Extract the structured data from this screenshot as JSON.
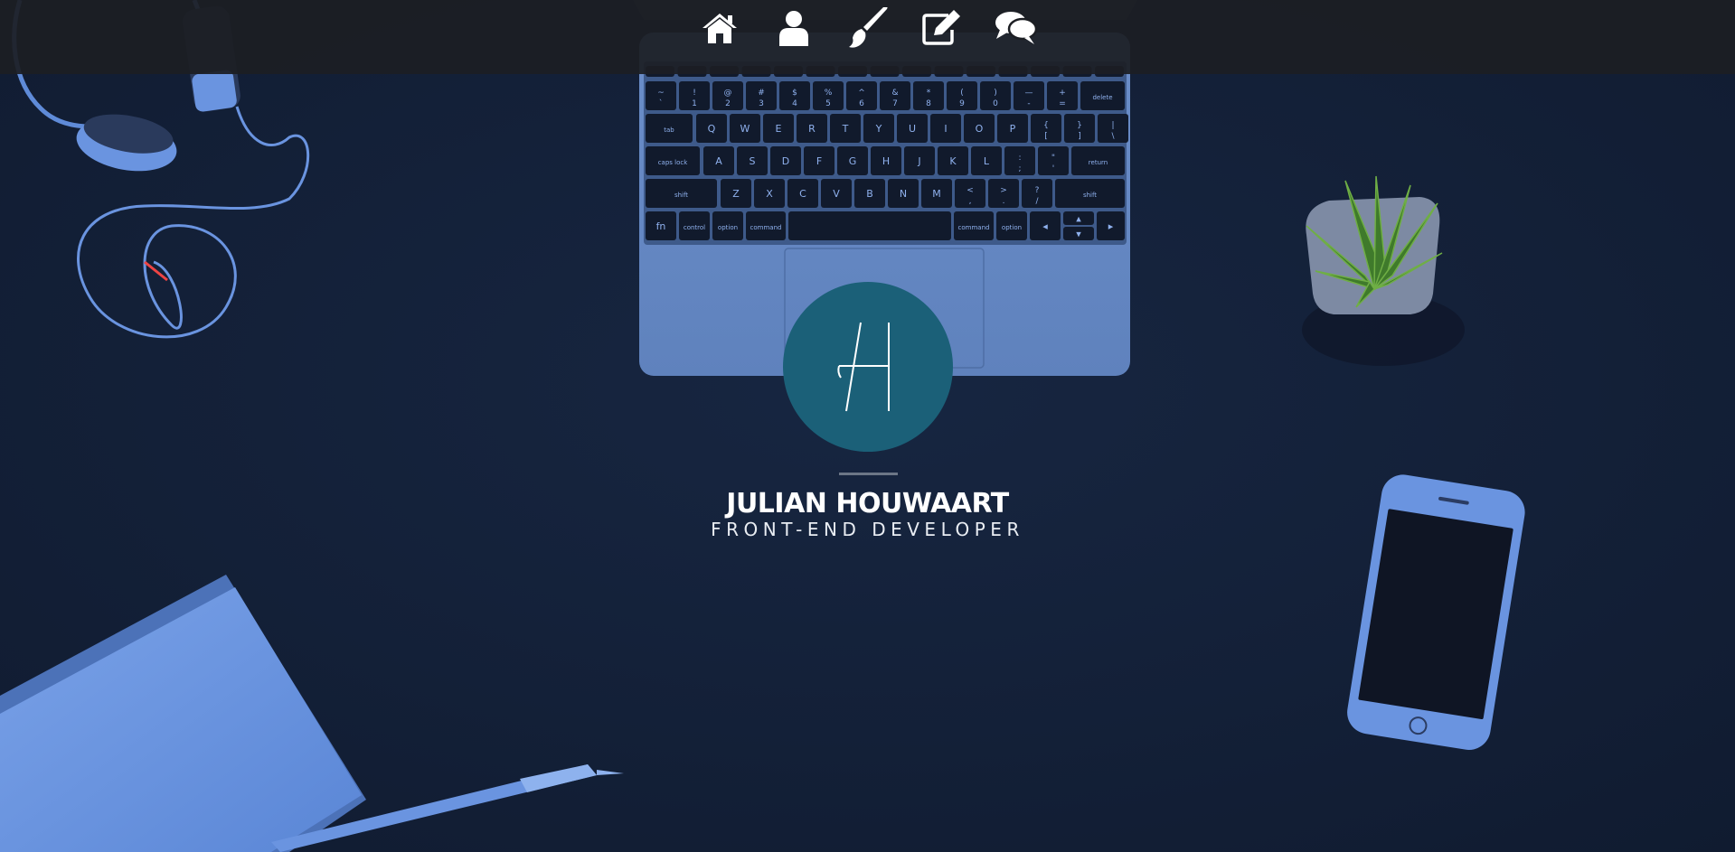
{
  "nav": {
    "items": [
      {
        "icon": "home-icon"
      },
      {
        "icon": "user-icon"
      },
      {
        "icon": "paintbrush-icon"
      },
      {
        "icon": "edit-icon"
      },
      {
        "icon": "chat-icon"
      }
    ]
  },
  "hero": {
    "logo_text": "H",
    "name": "JULIAN HOUWAART",
    "role": "FRONT-END DEVELOPER"
  },
  "keyboard": {
    "row1": [
      "~\n`",
      "!\n1",
      "@\n2",
      "#\n3",
      "$\n4",
      "%\n5",
      "^\n6",
      "&\n7",
      "*\n8",
      "(\n9",
      ")\n0",
      "—\n-",
      "+\n="
    ],
    "row1_end": "delete",
    "row2_start": "tab",
    "row2": [
      "Q",
      "W",
      "E",
      "R",
      "T",
      "Y",
      "U",
      "I",
      "O",
      "P",
      "{\n[",
      "}\n]",
      "|\n\\"
    ],
    "row3_start": "caps lock",
    "row3": [
      "A",
      "S",
      "D",
      "F",
      "G",
      "H",
      "J",
      "K",
      "L",
      ":\n;",
      "\"\n'"
    ],
    "row3_end": "return",
    "row4_start": "shift",
    "row4": [
      "Z",
      "X",
      "C",
      "V",
      "B",
      "N",
      "M",
      "<\n,",
      ">\n.",
      "?\n/"
    ],
    "row4_end": "shift",
    "row5": [
      "fn",
      "control",
      "option",
      "command",
      "",
      "command",
      "option"
    ]
  },
  "colors": {
    "background": "#13203a",
    "navbar": "#1c1e23",
    "accent_circle": "#1b6078",
    "prop_blue": "#6a94e0"
  }
}
